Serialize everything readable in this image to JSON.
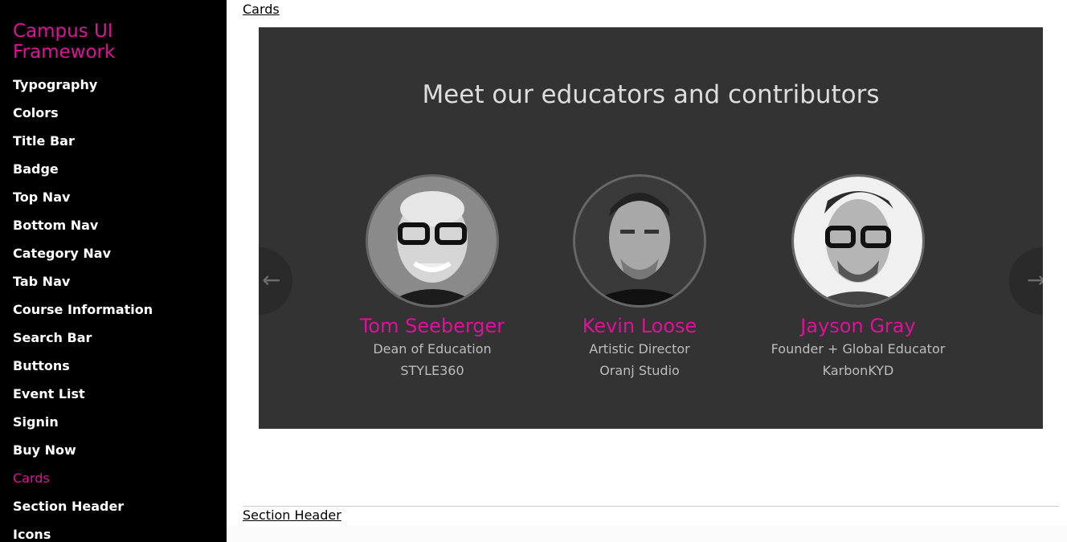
{
  "colors": {
    "accent": "#e0109a",
    "sidebar_bg": "#000000",
    "panel_bg": "#333333"
  },
  "sidebar": {
    "brand": "Campus UI Framework",
    "items": [
      {
        "label": "Typography"
      },
      {
        "label": "Colors"
      },
      {
        "label": "Title Bar"
      },
      {
        "label": "Badge"
      },
      {
        "label": "Top Nav"
      },
      {
        "label": "Bottom Nav"
      },
      {
        "label": "Category Nav"
      },
      {
        "label": "Tab Nav"
      },
      {
        "label": "Course Information"
      },
      {
        "label": "Search Bar"
      },
      {
        "label": "Buttons"
      },
      {
        "label": "Event List"
      },
      {
        "label": "Signin"
      },
      {
        "label": "Buy Now"
      },
      {
        "label": "Cards",
        "active": true
      },
      {
        "label": "Section Header"
      },
      {
        "label": "Icons"
      }
    ]
  },
  "main": {
    "section_link": "Cards",
    "next_section_link": "Section Header",
    "cards": {
      "title": "Meet our educators and contributors",
      "prev_icon": "arrow-left-icon",
      "next_icon": "arrow-right-icon",
      "prev_glyph": "←",
      "next_glyph": "→",
      "people": [
        {
          "name": "Tom Seeberger",
          "role": "Dean of Education",
          "org": "STYLE360"
        },
        {
          "name": "Kevin Loose",
          "role": "Artistic Director",
          "org": "Oranj Studio"
        },
        {
          "name": "Jayson Gray",
          "role": "Founder + Global Educator",
          "org": "KarbonKYD"
        }
      ]
    }
  }
}
